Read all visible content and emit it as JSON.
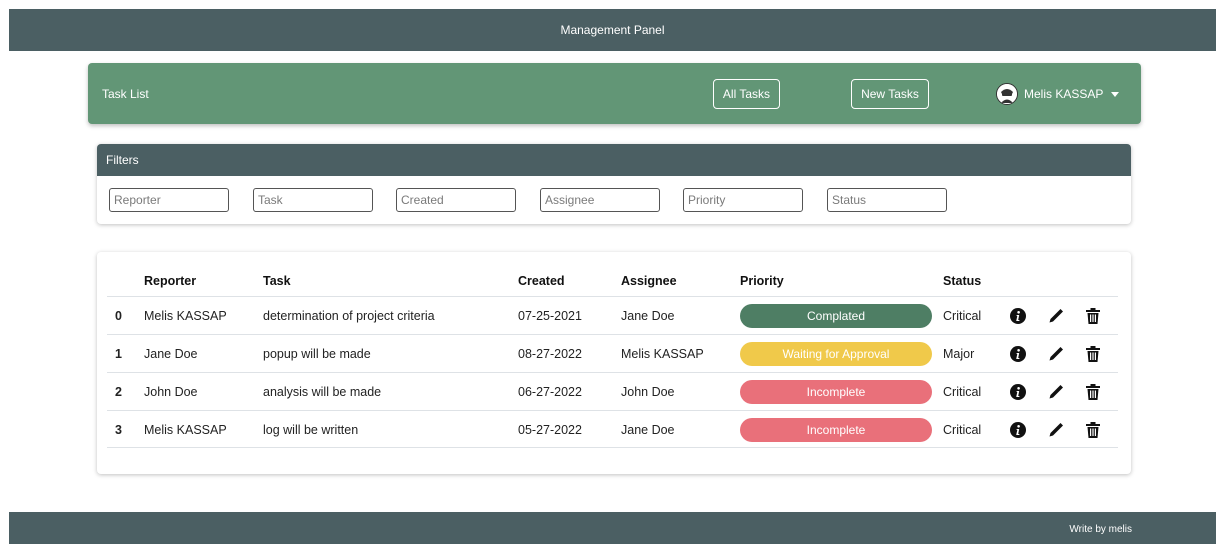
{
  "header": {
    "title": "Management Panel"
  },
  "navbar": {
    "brand": "Task List",
    "all_tasks_label": "All Tasks",
    "new_tasks_label": "New Tasks",
    "user_name": "Melis KASSAP",
    "color": "#629676"
  },
  "filters": {
    "title": "Filters",
    "placeholders": [
      "Reporter",
      "Task",
      "Created",
      "Assignee",
      "Priority",
      "Status"
    ]
  },
  "table": {
    "columns": [
      "Reporter",
      "Task",
      "Created",
      "Assignee",
      "Priority",
      "Status"
    ],
    "rows": [
      {
        "index": "0",
        "reporter": "Melis KASSAP",
        "task": "determination of project criteria",
        "created": "07-25-2021",
        "assignee": "Jane Doe",
        "priority": "Complated",
        "priority_color": "#4e7e64",
        "status": "Critical"
      },
      {
        "index": "1",
        "reporter": "Jane Doe",
        "task": "popup will be made",
        "created": "08-27-2022",
        "assignee": "Melis KASSAP",
        "priority": "Waiting for Approval",
        "priority_color": "#f0c94a",
        "status": "Major"
      },
      {
        "index": "2",
        "reporter": "John Doe",
        "task": "analysis will be made",
        "created": "06-27-2022",
        "assignee": "John Doe",
        "priority": "Incomplete",
        "priority_color": "#e9707a",
        "status": "Critical"
      },
      {
        "index": "3",
        "reporter": "Melis KASSAP",
        "task": "log will be written",
        "created": "05-27-2022",
        "assignee": "Jane Doe",
        "priority": "Incomplete",
        "priority_color": "#e9707a",
        "status": "Critical"
      }
    ],
    "row_icons": [
      "info-icon",
      "pencil-icon",
      "trash-icon"
    ]
  },
  "footer": {
    "text": "Write by melis"
  }
}
